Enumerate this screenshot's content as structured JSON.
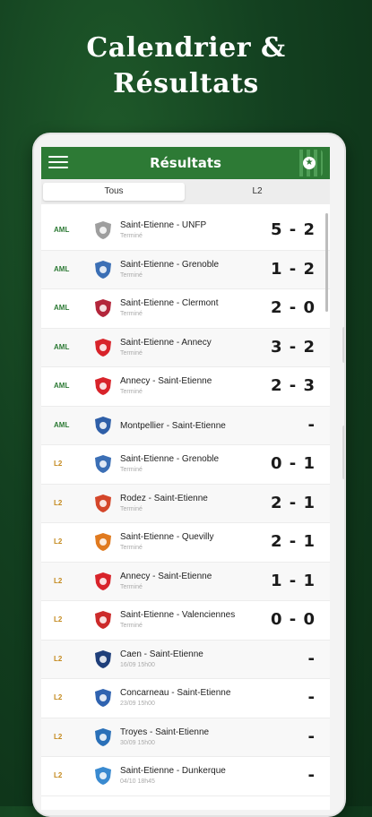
{
  "promo": {
    "line1": "Calendrier &",
    "line2": "Résultats"
  },
  "appbar": {
    "title": "Résultats"
  },
  "tabs": [
    {
      "label": "Tous"
    },
    {
      "label": "L2"
    }
  ],
  "matches": [
    {
      "comp": "AML",
      "teams": "Saint-Etienne - UNFP",
      "status": "Terminé",
      "score": "5 - 2",
      "logo": "unfp-logo-icon",
      "color": "#9e9e9e"
    },
    {
      "comp": "AML",
      "teams": "Saint-Etienne - Grenoble",
      "status": "Terminé",
      "score": "1 - 2",
      "logo": "grenoble-logo-icon",
      "color": "#3b6fb5"
    },
    {
      "comp": "AML",
      "teams": "Saint-Etienne - Clermont",
      "status": "Terminé",
      "score": "2 - 0",
      "logo": "clermont-logo-icon",
      "color": "#b3263b"
    },
    {
      "comp": "AML",
      "teams": "Saint-Etienne - Annecy",
      "status": "Terminé",
      "score": "3 - 2",
      "logo": "annecy-logo-icon",
      "color": "#d8232a"
    },
    {
      "comp": "AML",
      "teams": "Annecy - Saint-Etienne",
      "status": "Terminé",
      "score": "2 - 3",
      "logo": "annecy-logo-icon",
      "color": "#d8232a"
    },
    {
      "comp": "AML",
      "teams": "Montpellier - Saint-Etienne",
      "status": "",
      "score": "-",
      "logo": "montpellier-logo-icon",
      "color": "#2f5fa8"
    },
    {
      "comp": "L2",
      "teams": "Saint-Etienne - Grenoble",
      "status": "Terminé",
      "score": "0 - 1",
      "logo": "grenoble-logo-icon",
      "color": "#3b6fb5"
    },
    {
      "comp": "L2",
      "teams": "Rodez - Saint-Etienne",
      "status": "Terminé",
      "score": "2 - 1",
      "logo": "rodez-logo-icon",
      "color": "#d4462a"
    },
    {
      "comp": "L2",
      "teams": "Saint-Etienne - Quevilly",
      "status": "Terminé",
      "score": "2 - 1",
      "logo": "quevilly-logo-icon",
      "color": "#e07a1f"
    },
    {
      "comp": "L2",
      "teams": "Annecy - Saint-Etienne",
      "status": "Terminé",
      "score": "1 - 1",
      "logo": "annecy-logo-icon",
      "color": "#d8232a"
    },
    {
      "comp": "L2",
      "teams": "Saint-Etienne - Valenciennes",
      "status": "Terminé",
      "score": "0 - 0",
      "logo": "valenciennes-logo-icon",
      "color": "#cc2a2a"
    },
    {
      "comp": "L2",
      "teams": "Caen - Saint-Etienne",
      "status": "16/09 15h00",
      "score": "-",
      "logo": "caen-logo-icon",
      "color": "#1f3f7a"
    },
    {
      "comp": "L2",
      "teams": "Concarneau - Saint-Etienne",
      "status": "23/09 15h00",
      "score": "-",
      "logo": "concarneau-logo-icon",
      "color": "#2f63b0"
    },
    {
      "comp": "L2",
      "teams": "Troyes - Saint-Etienne",
      "status": "30/09 15h00",
      "score": "-",
      "logo": "troyes-logo-icon",
      "color": "#2a70b8"
    },
    {
      "comp": "L2",
      "teams": "Saint-Etienne - Dunkerque",
      "status": "04/10 18h45",
      "score": "-",
      "logo": "dunkerque-logo-icon",
      "color": "#3a8ad0"
    }
  ]
}
